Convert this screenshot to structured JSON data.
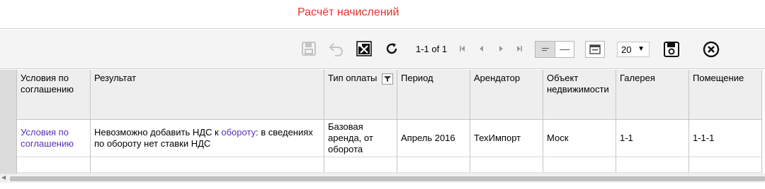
{
  "page": {
    "title": "Расчёт начислений"
  },
  "toolbar": {
    "pager_text": "1-1 of 1",
    "page_size": "20",
    "icons": [
      "save-icon",
      "undo-icon",
      "excel-export-icon",
      "refresh-icon",
      "first-page-icon",
      "prev-page-icon",
      "next-page-icon",
      "last-page-icon",
      "compact-view-icon",
      "wide-view-icon",
      "column-chooser-icon",
      "save-settings-icon",
      "close-icon"
    ]
  },
  "grid": {
    "columns": [
      "Условия по соглашению",
      "Результат",
      "Тип оплаты",
      "Период",
      "Арендатор",
      "Объект недвижимости",
      "Галерея",
      "Помещение"
    ],
    "rows": [
      {
        "conditions": "Условия по соглашению",
        "result_before": "Невозможно добавить НДС к ",
        "result_link": "обороту",
        "result_after": ": в сведениях по обороту нет ставки НДС",
        "payment_type": "Базовая аренда, от оборота",
        "period": "Апрель 2016",
        "tenant": "ТехИмпорт",
        "property": "Моск",
        "gallery": "1-1",
        "room": "1-1-1"
      }
    ]
  },
  "colors": {
    "title": "#d9372b",
    "link": "#5b2fb8",
    "header_bg": "#eeeeee",
    "toolbar_bg": "#f4f4f4"
  }
}
